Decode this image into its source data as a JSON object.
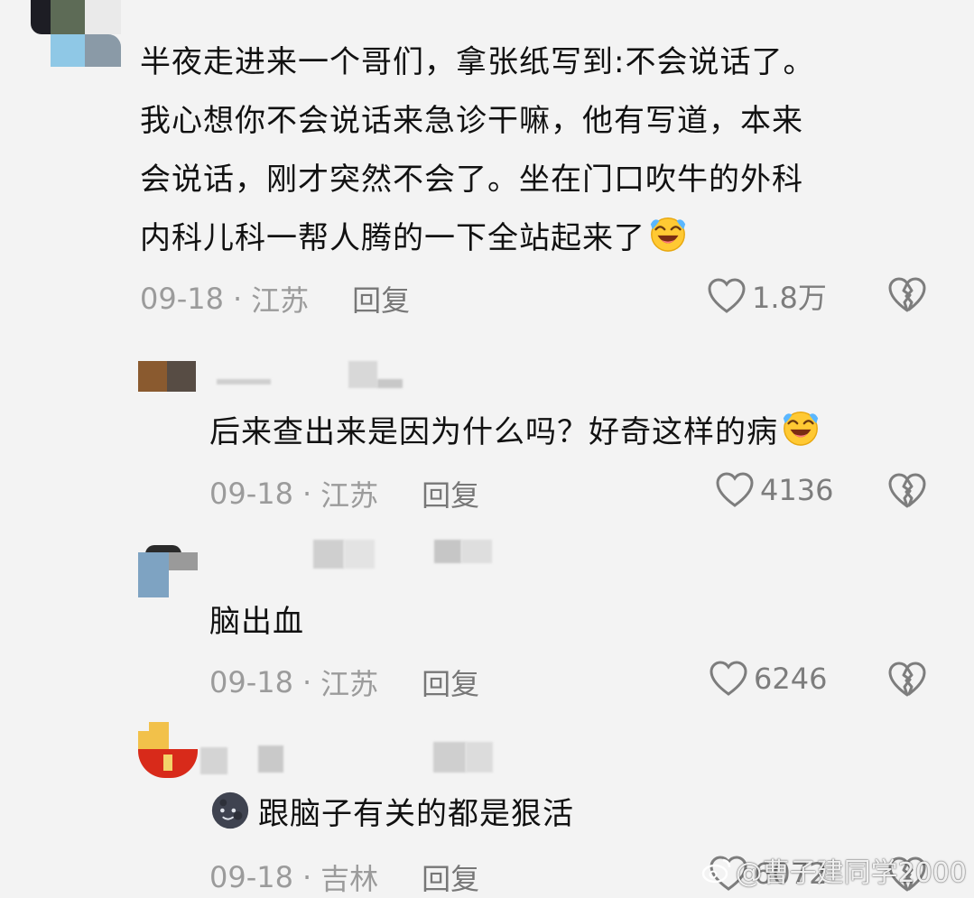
{
  "comments": [
    {
      "text_lines": [
        "半夜走进来一个哥们，拿张纸写到:不会说话了。",
        "我心想你不会说话来急诊干嘛，他有写道，本来",
        "会说话，刚才突然不会了。坐在门口吹牛的外科",
        "内科儿科一帮人腾的一下全站起来了"
      ],
      "emoji": "laughing-tears-icon",
      "date": "09-18",
      "location": "江苏",
      "reply": "回复",
      "likes": "1.8万"
    },
    {
      "text": "后来查出来是因为什么吗？好奇这样的病",
      "emoji": "laughing-tears-icon",
      "date": "09-18",
      "location": "江苏",
      "reply": "回复",
      "likes": "4136"
    },
    {
      "text": "脑出血",
      "date": "09-18",
      "location": "江苏",
      "reply": "回复",
      "likes": "6246"
    },
    {
      "text": "跟脑子有关的都是狠活",
      "emoji": "new-moon-face-icon",
      "date": "09-18",
      "location": "吉林",
      "reply": "回复",
      "likes": "6072"
    }
  ],
  "separator": "·",
  "watermark": "@曹子建同学2000",
  "colors": {
    "background": "#f3f3f3",
    "text": "#111111",
    "meta": "#9b9b9b",
    "icon": "#7d7d7d"
  }
}
